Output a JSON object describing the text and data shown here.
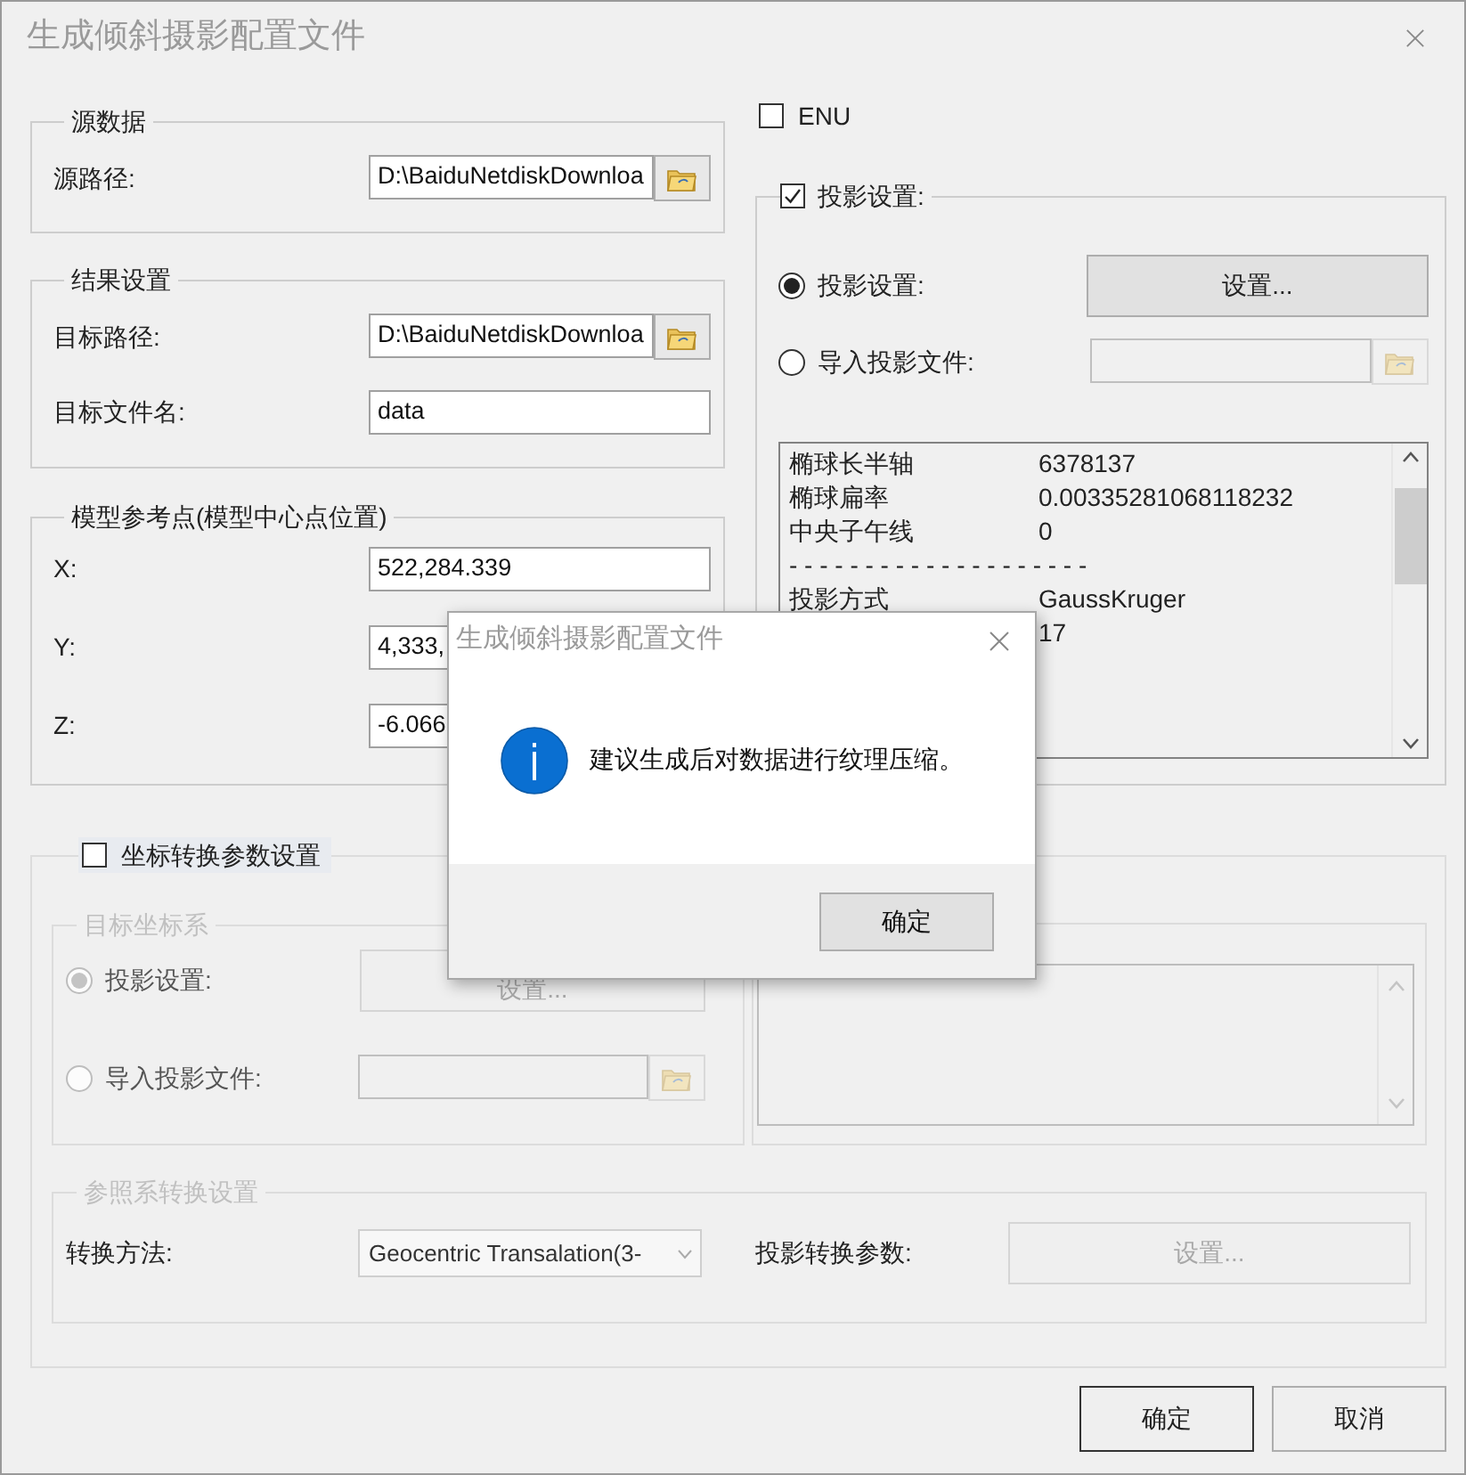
{
  "window": {
    "title": "生成倾斜摄影配置文件"
  },
  "source": {
    "title": "源数据",
    "path_label": "源路径:",
    "path_value": "D:\\BaiduNetdiskDownloa"
  },
  "result": {
    "title": "结果设置",
    "path_label": "目标路径:",
    "path_value": "D:\\BaiduNetdiskDownloa",
    "filename_label": "目标文件名:",
    "filename_value": "data"
  },
  "reference_point": {
    "title": "模型参考点(模型中心点位置)",
    "fields": [
      {
        "label": "X:",
        "value": "522,284.339"
      },
      {
        "label": "Y:",
        "value": "4,333,"
      },
      {
        "label": "Z:",
        "value": "-6.066"
      }
    ]
  },
  "enu": {
    "label": "ENU",
    "checked": false
  },
  "projection": {
    "label": "投影设置:",
    "checked": true,
    "options": [
      {
        "kind": "button",
        "label": "投影设置:",
        "selected": true,
        "button": "设置..."
      },
      {
        "kind": "file",
        "label": "导入投影文件:",
        "selected": false
      }
    ],
    "info_rows": [
      {
        "label": "椭球长半轴",
        "value": "6378137"
      },
      {
        "label": "椭球扁率",
        "value": "0.00335281068118232"
      },
      {
        "label": "中央子午线",
        "value": "0"
      },
      {
        "label": "- - - - - - - - - - - - - - - - - - - -"
      },
      {
        "label": "投影方式",
        "value": "GaussKruger"
      },
      {
        "value": "17"
      }
    ]
  },
  "coordinate_transform": {
    "label": "坐标转换参数设置",
    "checked": false,
    "target": {
      "title": "目标坐标系",
      "options": [
        {
          "kind": "button",
          "label": "投影设置:",
          "selected": true,
          "button": "设置..."
        },
        {
          "kind": "file",
          "label": "导入投影文件:",
          "selected": false
        }
      ]
    },
    "reference": {
      "title": "参照系转换设置",
      "method_label": "转换方法:",
      "method_value": "Geocentric Transalation(3-",
      "params_label": "投影转换参数:",
      "params_button": "设置..."
    }
  },
  "buttons": [
    {
      "label": "确定",
      "default": true
    },
    {
      "label": "取消",
      "default": false
    }
  ],
  "message_box": {
    "title": "生成倾斜摄影配置文件",
    "message": "建议生成后对数据进行纹理压缩。",
    "button": "确定"
  }
}
